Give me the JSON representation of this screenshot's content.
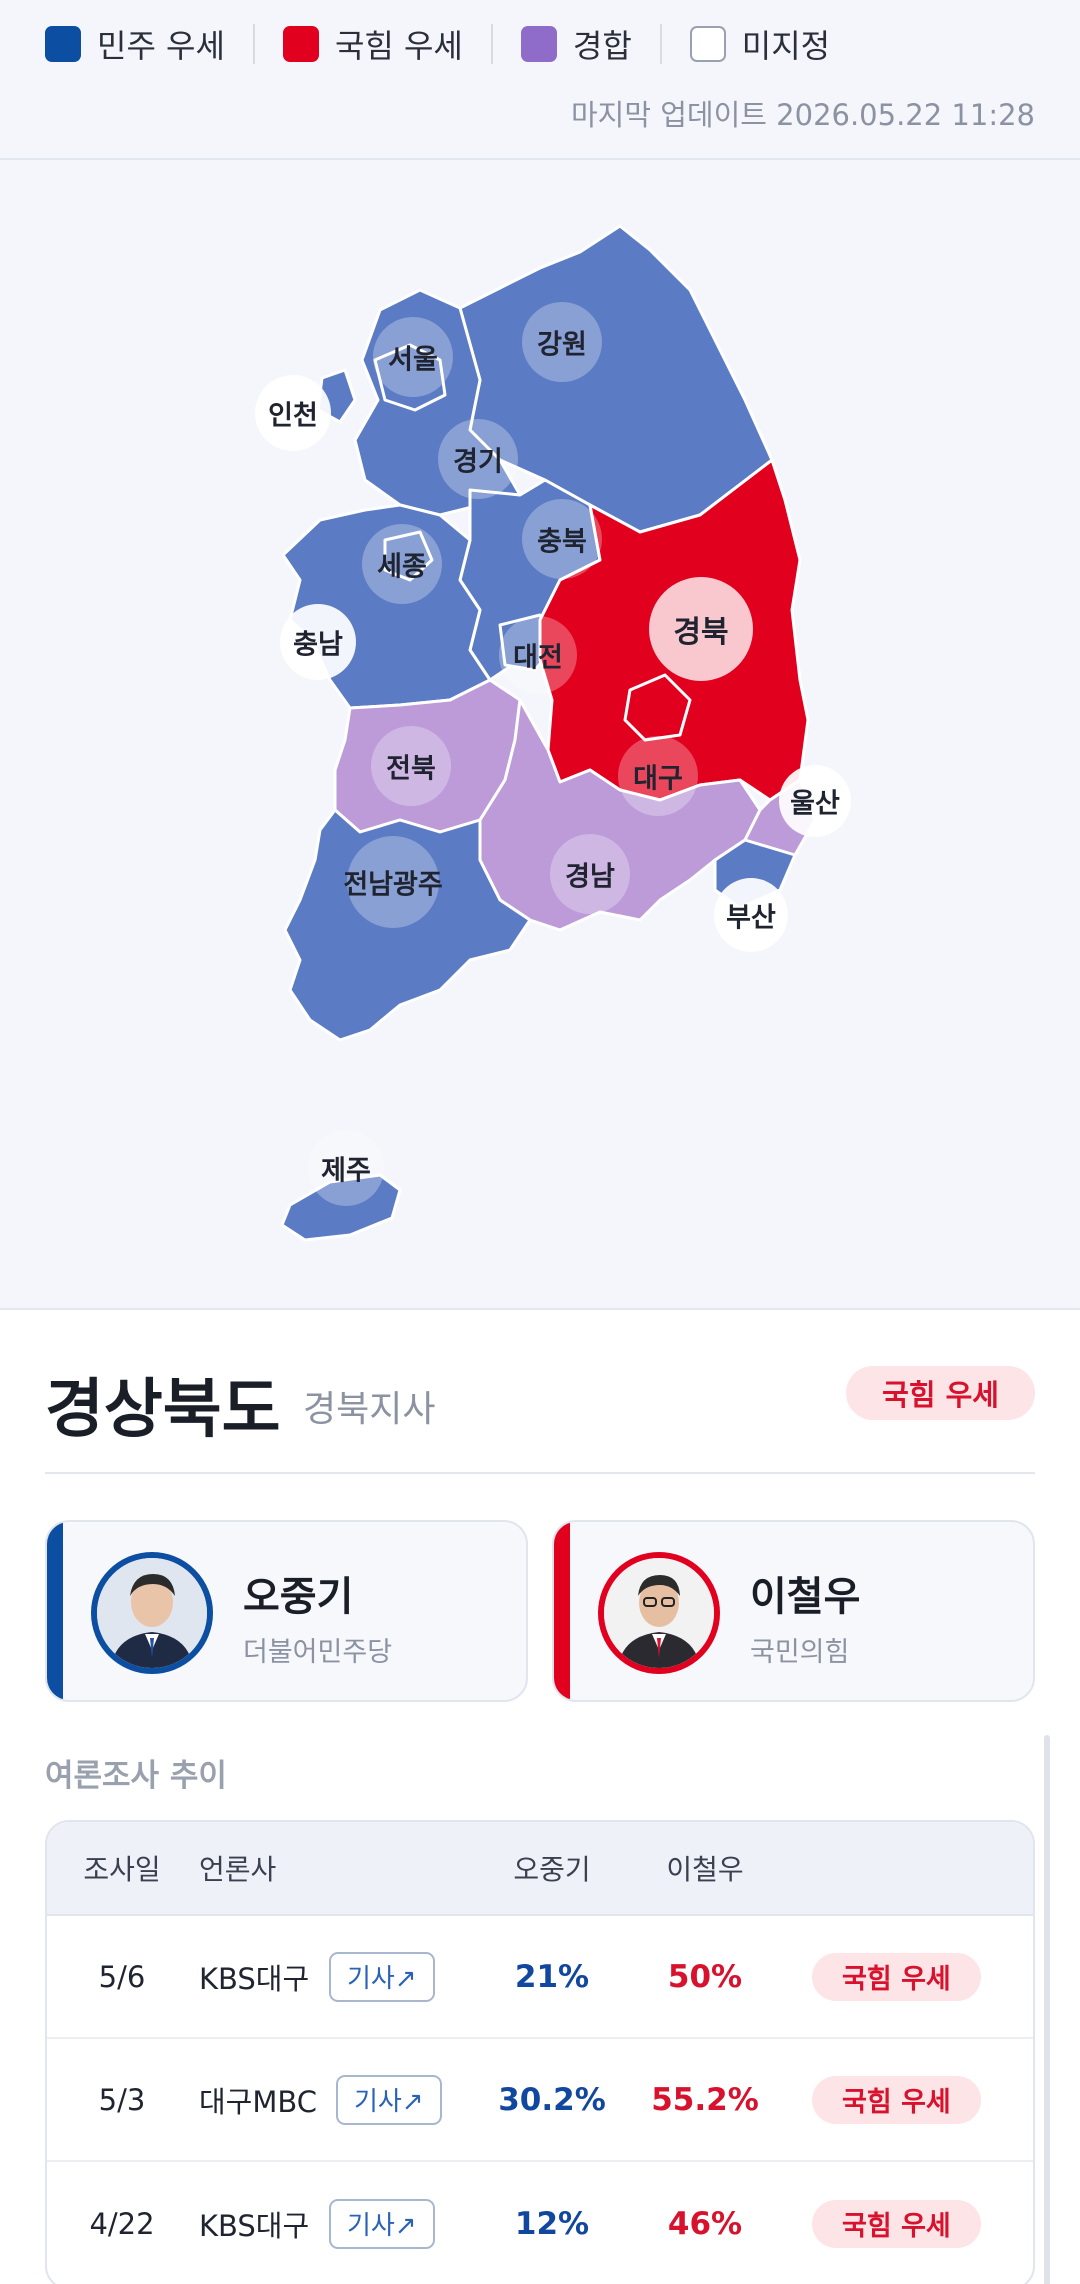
{
  "legend": {
    "items": [
      {
        "label": "민주 우세",
        "color": "#0b4ea2"
      },
      {
        "label": "국힘 우세",
        "color": "#e2001f"
      },
      {
        "label": "경합",
        "color": "#8f6cc9"
      },
      {
        "label": "미지정",
        "color": "#ffffff"
      }
    ]
  },
  "update_text": "마지막 업데이트 2026.05.22 11:28",
  "map": {
    "colors": {
      "dem": "#5b7cc4",
      "ppp": "#e2001f",
      "tossup": "#bd9bd9",
      "border": "#ffffff"
    },
    "regions": [
      {
        "name": "서울",
        "status": "dem"
      },
      {
        "name": "인천",
        "status": "dem"
      },
      {
        "name": "강원",
        "status": "dem"
      },
      {
        "name": "경기",
        "status": "dem"
      },
      {
        "name": "충북",
        "status": "dem"
      },
      {
        "name": "세종",
        "status": "dem"
      },
      {
        "name": "충남",
        "status": "dem"
      },
      {
        "name": "경북",
        "status": "ppp"
      },
      {
        "name": "대전",
        "status": "dem"
      },
      {
        "name": "전북",
        "status": "tossup"
      },
      {
        "name": "대구",
        "status": "ppp"
      },
      {
        "name": "울산",
        "status": "tossup"
      },
      {
        "name": "전남광주",
        "status": "dem"
      },
      {
        "name": "경남",
        "status": "tossup"
      },
      {
        "name": "부산",
        "status": "dem"
      },
      {
        "name": "제주",
        "status": "dem"
      }
    ]
  },
  "detail": {
    "title": "경상북도",
    "subtitle": "경북지사",
    "status": "국힘 우세",
    "candidates": [
      {
        "name": "오중기",
        "party": "더불어민주당",
        "color": "#0b4ea2"
      },
      {
        "name": "이철우",
        "party": "국민의힘",
        "color": "#e2001f"
      }
    ]
  },
  "polls": {
    "heading": "여론조사 추이",
    "columns": {
      "date": "조사일",
      "media": "언론사",
      "cand_a": "오중기",
      "cand_b": "이철우"
    },
    "rows": [
      {
        "date": "5/6",
        "media": "KBS대구",
        "article": "기사↗",
        "a": "21%",
        "b": "50%",
        "status": "국힘 우세"
      },
      {
        "date": "5/3",
        "media": "대구MBC",
        "article": "기사↗",
        "a": "30.2%",
        "b": "55.2%",
        "status": "국힘 우세"
      },
      {
        "date": "4/22",
        "media": "KBS대구",
        "article": "기사↗",
        "a": "12%",
        "b": "46%",
        "status": "국힘 우세"
      }
    ]
  }
}
